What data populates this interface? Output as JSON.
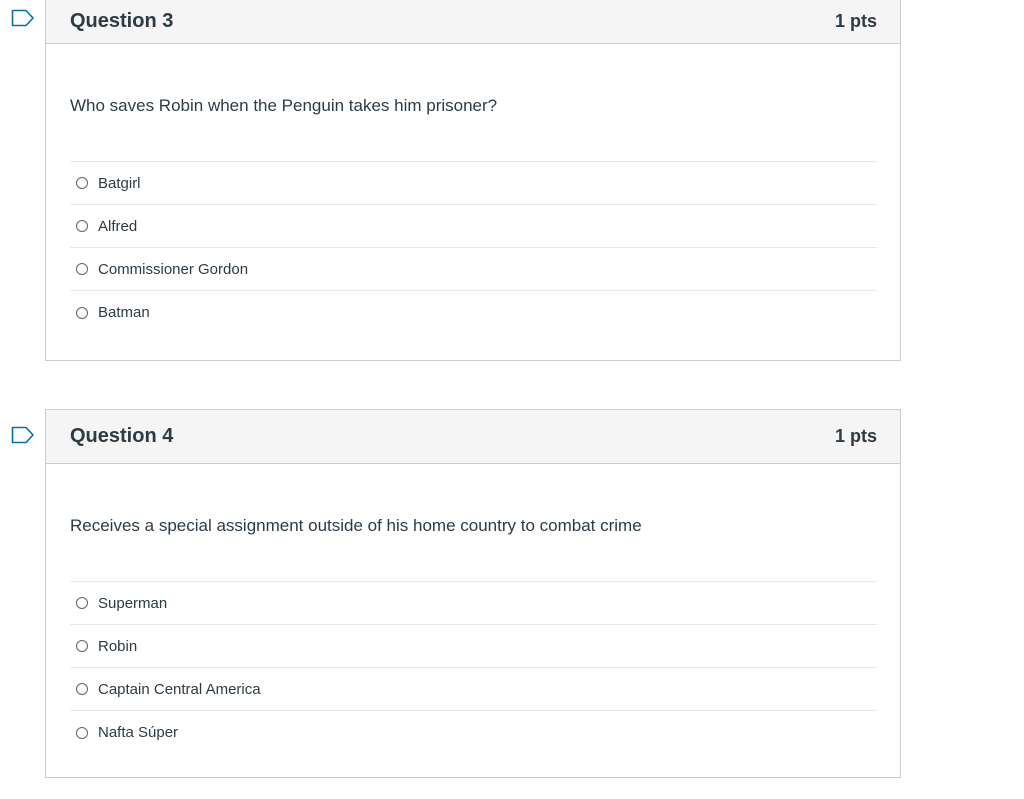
{
  "questions": [
    {
      "title": "Question 3",
      "points": "1 pts",
      "text": "Who saves Robin when the Penguin takes him prisoner?",
      "answers": [
        "Batgirl",
        "Alfred",
        "Commissioner Gordon",
        "Batman"
      ]
    },
    {
      "title": "Question 4",
      "points": "1 pts",
      "text": "Receives a special assignment outside of his home country to combat crime",
      "answers": [
        "Superman",
        "Robin",
        "Captain Central America",
        "Nafta Súper"
      ]
    }
  ],
  "icons": {
    "flag": "flag-question-icon"
  },
  "colors": {
    "flag": "#0770a3",
    "header_bg": "#f5f5f5",
    "border": "#c7cdd1",
    "text": "#2d3b45"
  }
}
